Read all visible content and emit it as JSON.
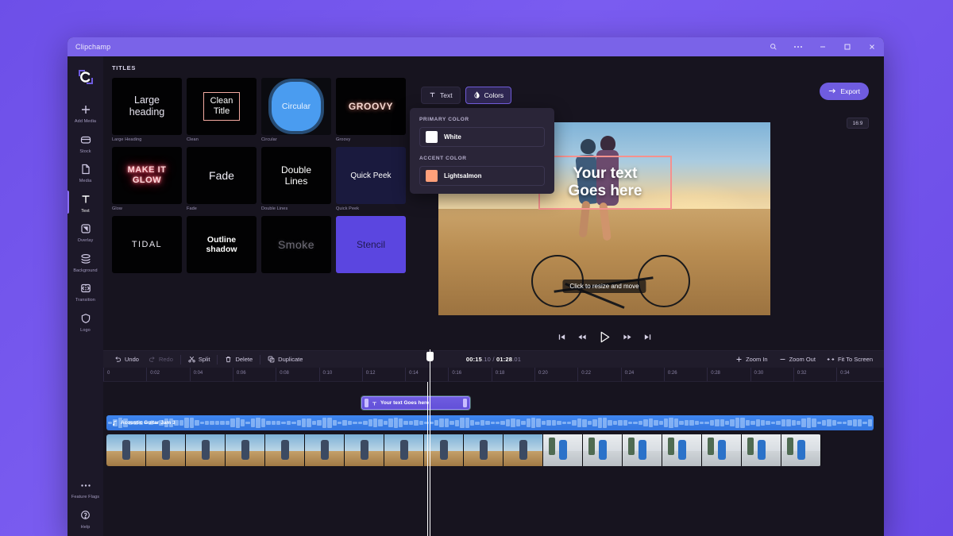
{
  "window": {
    "app_title": "Clipchamp",
    "controls": [
      {
        "name": "search-icon",
        "glyph": "search"
      },
      {
        "name": "more-options-icon",
        "glyph": "dots"
      },
      {
        "name": "minimize-icon",
        "glyph": "minimize"
      },
      {
        "name": "maximize-icon",
        "glyph": "maximize"
      },
      {
        "name": "close-icon",
        "glyph": "close"
      }
    ]
  },
  "sidebar": {
    "logo_label": "Clipchamp",
    "items": [
      {
        "id": "add-media",
        "label": "Add Media",
        "icon": "plus-icon"
      },
      {
        "id": "stock",
        "label": "Stock",
        "icon": "stock-icon"
      },
      {
        "id": "media",
        "label": "Media",
        "icon": "document-icon"
      },
      {
        "id": "text",
        "label": "Text",
        "icon": "text-icon",
        "active": true
      },
      {
        "id": "overlay",
        "label": "Overlay",
        "icon": "overlay-icon"
      },
      {
        "id": "background",
        "label": "Background",
        "icon": "layers-icon"
      },
      {
        "id": "transition",
        "label": "Transition",
        "icon": "transition-icon"
      },
      {
        "id": "logo",
        "label": "Logo",
        "icon": "shield-icon"
      }
    ],
    "bottom_items": [
      {
        "id": "feature-flags",
        "label": "Feature Flags",
        "icon": "dots-icon"
      },
      {
        "id": "help",
        "label": "Help",
        "icon": "help-icon"
      }
    ]
  },
  "library": {
    "heading": "TITLES",
    "titles": [
      {
        "caption": "Large Heading",
        "preview": "Large\nheading",
        "style": "large"
      },
      {
        "caption": "Clean",
        "preview": "Clean\nTitle",
        "style": "clean"
      },
      {
        "caption": "Circular",
        "preview": "Circular",
        "style": "circular"
      },
      {
        "caption": "Groovy",
        "preview": "GROOVY",
        "style": "groovy"
      },
      {
        "caption": "Glow",
        "preview": "MAKE IT\nGLOW",
        "style": "glow"
      },
      {
        "caption": "Fade",
        "preview": "Fade",
        "style": "fade"
      },
      {
        "caption": "Double Lines",
        "preview": "Double\nLines",
        "style": "doublelines"
      },
      {
        "caption": "Quick Peek",
        "preview": "Quick Peek",
        "style": "quickpeek"
      },
      {
        "caption": "",
        "preview": "TIDAL",
        "style": "tidal"
      },
      {
        "caption": "",
        "preview": "Outline\nshadow",
        "style": "outline"
      },
      {
        "caption": "",
        "preview": "Smoke",
        "style": "smoke"
      },
      {
        "caption": "",
        "preview": "Stencil",
        "style": "stencil"
      }
    ]
  },
  "property_toolbar": {
    "text_tab": "Text",
    "colors_tab": "Colors"
  },
  "color_popover": {
    "primary_label": "PRIMARY COLOR",
    "primary_value": "White",
    "primary_hex": "#ffffff",
    "accent_label": "ACCENT COLOR",
    "accent_value": "Lightsalmon",
    "accent_hex": "#ffa07a"
  },
  "export": {
    "label": "Export",
    "icon": "export-arrow-icon"
  },
  "preview": {
    "aspect_ratio": "16:9",
    "overlay_text": "Your text\nGoes here",
    "hint": "Click to resize and move",
    "selection_color": "#f5918e",
    "controls": [
      {
        "id": "skip-to-start",
        "icon": "skip-start-icon"
      },
      {
        "id": "rewind",
        "icon": "rewind-icon"
      },
      {
        "id": "play",
        "icon": "play-icon"
      },
      {
        "id": "fast-forward",
        "icon": "fast-forward-icon"
      },
      {
        "id": "skip-to-end",
        "icon": "skip-end-icon"
      }
    ]
  },
  "timeline": {
    "toolbar": {
      "undo": "Undo",
      "redo": "Redo",
      "split": "Split",
      "delete": "Delete",
      "duplicate": "Duplicate",
      "zoom_in": "Zoom In",
      "zoom_out": "Zoom Out",
      "fit_to_screen": "Fit To Screen"
    },
    "current_time": "00:15",
    "current_frames": ".10",
    "total_time": "01:28",
    "total_frames": ".01",
    "separator": "/",
    "ruler_ticks": [
      "0",
      "0:02",
      "0:04",
      "0:06",
      "0:08",
      "0:10",
      "0:12",
      "0:14",
      "0:16",
      "0:18",
      "0:20",
      "0:22",
      "0:24",
      "0:26",
      "0:28",
      "0:30",
      "0:32",
      "0:34"
    ],
    "clips": {
      "text_clip": "Your text Goes here",
      "audio_clip": "Acoustic Guitar Jam 3",
      "video_clip": "video-track"
    }
  }
}
